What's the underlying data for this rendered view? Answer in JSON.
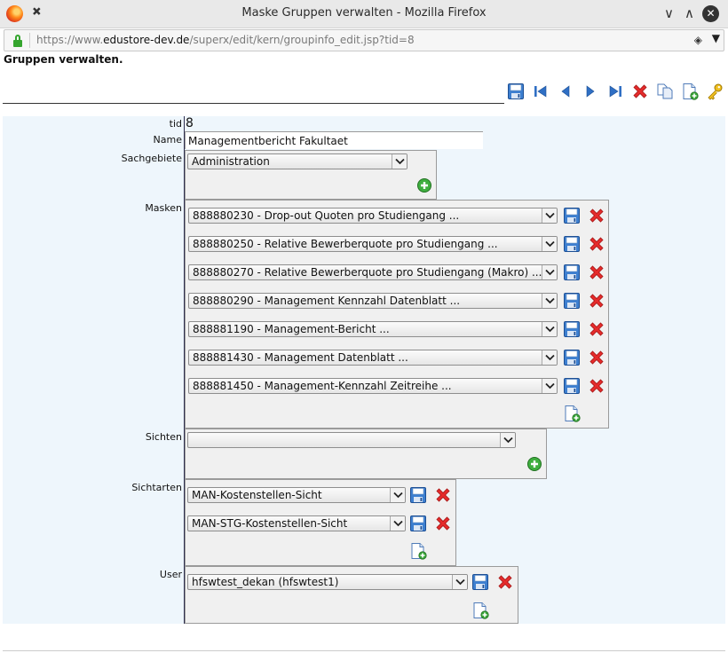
{
  "window": {
    "title": "Maske Gruppen verwalten - Mozilla Firefox",
    "minimize_glyph": "∨",
    "maximize_glyph": "∧",
    "close_glyph": "✕"
  },
  "urlbar": {
    "scheme": "https://www.",
    "host": "edustore-dev.de",
    "path": "/superx/edit/kern/groupinfo_edit.jsp?tid=8"
  },
  "page": {
    "heading": "Gruppen verwalten."
  },
  "toolbar": {
    "icons": [
      "save-icon",
      "first-record-icon",
      "previous-record-icon",
      "next-record-icon",
      "last-record-icon",
      "delete-icon",
      "copy-icon",
      "new-record-icon",
      "key-icon"
    ]
  },
  "form": {
    "tid_label": "tid",
    "tid_value": "8",
    "name_label": "Name",
    "name_value": "Managementbericht Fakultaet",
    "sachgebiete_label": "Sachgebiete",
    "sachgebiete_value": "Administration",
    "masken_label": "Masken",
    "masken": [
      "888880230 - Drop-out Quoten pro Studiengang ...",
      "888880250 - Relative Bewerberquote pro Studiengang ...",
      "888880270 - Relative Bewerberquote pro Studiengang (Makro) ...",
      "888880290 - Management Kennzahl Datenblatt ...",
      "888881190 - Management-Bericht ...",
      "888881430 - Management Datenblatt ...",
      "888881450 - Management-Kennzahl Zeitreihe ..."
    ],
    "sichten_label": "Sichten",
    "sichten_value": "",
    "sichtarten_label": "Sichtarten",
    "sichtarten": [
      "MAN-Kostenstellen-Sicht",
      "MAN-STG-Kostenstellen-Sicht"
    ],
    "user_label": "User",
    "user_value": "hfswtest_dekan (hfswtest1)"
  },
  "colors": {
    "form_background": "#eef6fc",
    "panel_background": "#f0f0f0",
    "accent_blue": "#2f6fc4",
    "delete_red": "#e02020",
    "add_green": "#3aa63a"
  }
}
